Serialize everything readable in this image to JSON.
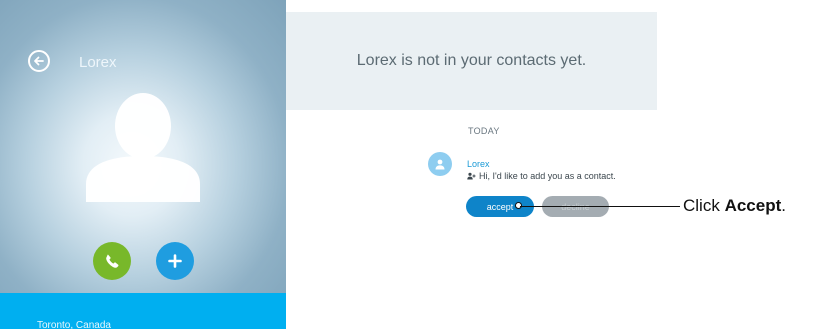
{
  "contact": {
    "name": "Lorex",
    "location": "Toronto, Canada"
  },
  "header": {
    "message": "Lorex is not in your contacts yet."
  },
  "chat": {
    "day_label": "TODAY",
    "message": {
      "sender": "Lorex",
      "text": "Hi, I'd like to add you as a contact."
    },
    "accept_label": "accept",
    "decline_label": "decline"
  },
  "callout": {
    "prefix": "Click ",
    "emphasis": "Accept",
    "suffix": "."
  },
  "icons": {
    "back": "back-arrow-icon",
    "call": "phone-icon",
    "add": "plus-icon",
    "avatar": "person-icon",
    "request": "add-contact-icon"
  },
  "colors": {
    "call_button": "#78b82a",
    "add_button": "#1f9de0",
    "location_bar": "#00aff0",
    "accept_button": "#0e84c9",
    "decline_button": "#a4acb2",
    "sender_name": "#1a9ad6"
  }
}
